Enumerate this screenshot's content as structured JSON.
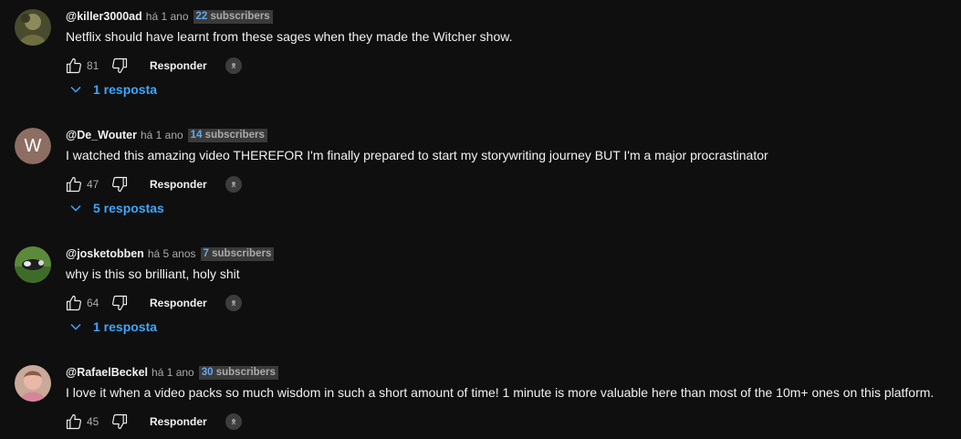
{
  "comments": [
    {
      "author": "@killer3000ad",
      "time": "há 1 ano",
      "subscriber_count": "22",
      "subscriber_label": "subscribers",
      "text": "Netflix should have learnt from these sages when they made the Witcher show.",
      "likes": "81",
      "reply_label": "Responder",
      "replies_label": "1 resposta",
      "avatar": "photo"
    },
    {
      "author": "@De_Wouter",
      "time": "há 1 ano",
      "subscriber_count": "14",
      "subscriber_label": "subscribers",
      "text": "I watched this amazing video THEREFOR I'm finally prepared to start my storywriting journey BUT I'm a major procrastinator",
      "likes": "47",
      "reply_label": "Responder",
      "replies_label": "5 respostas",
      "avatar_letter": "W"
    },
    {
      "author": "@josketobben",
      "time": "há 5 anos",
      "subscriber_count": "7",
      "subscriber_label": "subscribers",
      "text": "why is this so brilliant, holy shit",
      "likes": "64",
      "reply_label": "Responder",
      "replies_label": "1 resposta",
      "avatar": "photo"
    },
    {
      "author": "@RafaelBeckel",
      "time": "há 1 ano",
      "subscriber_count": "30",
      "subscriber_label": "subscribers",
      "text": "I love it when a video packs so much wisdom in such a short amount of time! 1 minute is more valuable here than most of the 10m+ ones on this platform.",
      "likes": "45",
      "reply_label": "Responder",
      "avatar": "photo"
    }
  ],
  "icons": {
    "like": "thumbs-up-icon",
    "dislike": "thumbs-down-icon",
    "creator_heart": "creator-heart-icon",
    "expand": "chevron-down-icon"
  },
  "colors": {
    "background": "#0f0f0f",
    "reply_link": "#3ea6ff",
    "badge_number": "#65a7ee",
    "avatar_letter_bg": "#8d6e63"
  }
}
